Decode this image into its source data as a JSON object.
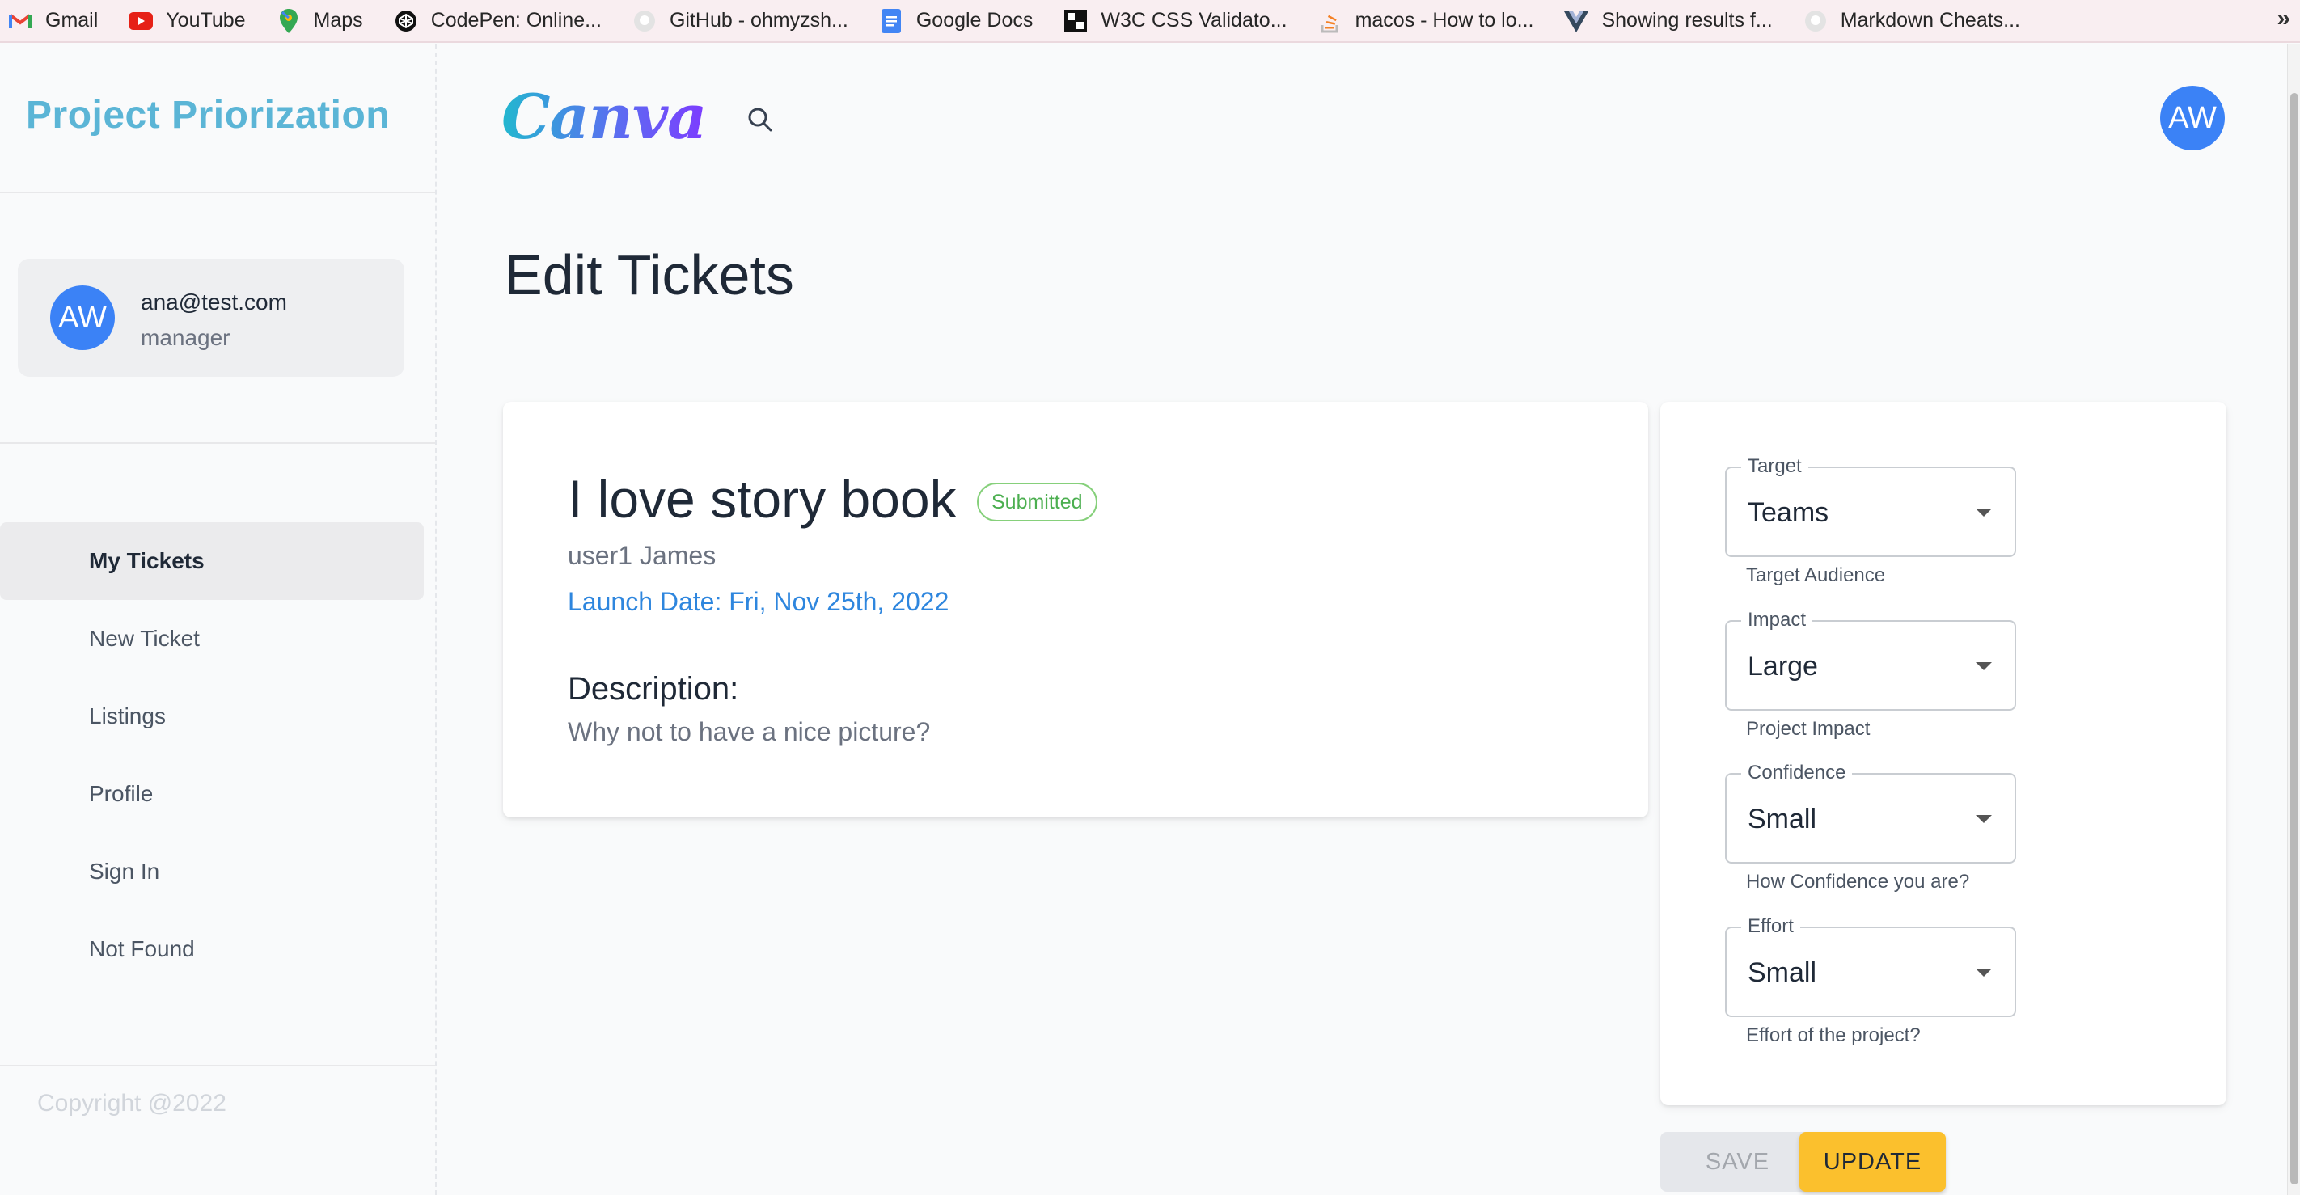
{
  "bookmarks": [
    {
      "label": "Gmail",
      "icon": "gmail-icon"
    },
    {
      "label": "YouTube",
      "icon": "youtube-icon"
    },
    {
      "label": "Maps",
      "icon": "maps-icon"
    },
    {
      "label": "CodePen: Online...",
      "icon": "codepen-icon"
    },
    {
      "label": "GitHub - ohmyzsh...",
      "icon": "github-icon"
    },
    {
      "label": "Google Docs",
      "icon": "google-docs-icon"
    },
    {
      "label": "W3C CSS Validato...",
      "icon": "w3c-icon"
    },
    {
      "label": "macos - How to lo...",
      "icon": "stackoverflow-icon"
    },
    {
      "label": "Showing results f...",
      "icon": "vue-icon"
    },
    {
      "label": "Markdown Cheats...",
      "icon": "github-icon"
    }
  ],
  "bookmarks_more": "»",
  "sidebar": {
    "brand": "Project Priorization",
    "user": {
      "initials": "AW",
      "email": "ana@test.com",
      "role": "manager"
    },
    "nav": [
      {
        "label": "My Tickets",
        "active": true
      },
      {
        "label": "New Ticket"
      },
      {
        "label": "Listings"
      },
      {
        "label": "Profile"
      },
      {
        "label": "Sign In"
      },
      {
        "label": "Not Found"
      }
    ],
    "copyright": "Copyright @2022"
  },
  "header": {
    "logo": "Canva",
    "avatar_initials": "AW"
  },
  "page_title": "Edit Tickets",
  "ticket": {
    "title": "I love story book",
    "status": "Submitted",
    "author": "user1 James",
    "launch_date": "Launch Date: Fri, Nov 25th, 2022",
    "description_label": "Description:",
    "description": "Why not to have a nice picture?"
  },
  "form": {
    "target": {
      "label": "Target",
      "value": "Teams",
      "helper": "Target Audience"
    },
    "impact": {
      "label": "Impact",
      "value": "Large",
      "helper": "Project Impact"
    },
    "confidence": {
      "label": "Confidence",
      "value": "Small",
      "helper": "How Confidence you are?"
    },
    "effort": {
      "label": "Effort",
      "value": "Small",
      "helper": "Effort of the project?"
    }
  },
  "buttons": {
    "save": "SAVE",
    "update": "UPDATE"
  },
  "colors": {
    "brand": "#5bb5d6",
    "avatar": "#3b82f6",
    "status": "#4caf50",
    "link": "#2e86de",
    "update_button": "#fbc02d"
  }
}
